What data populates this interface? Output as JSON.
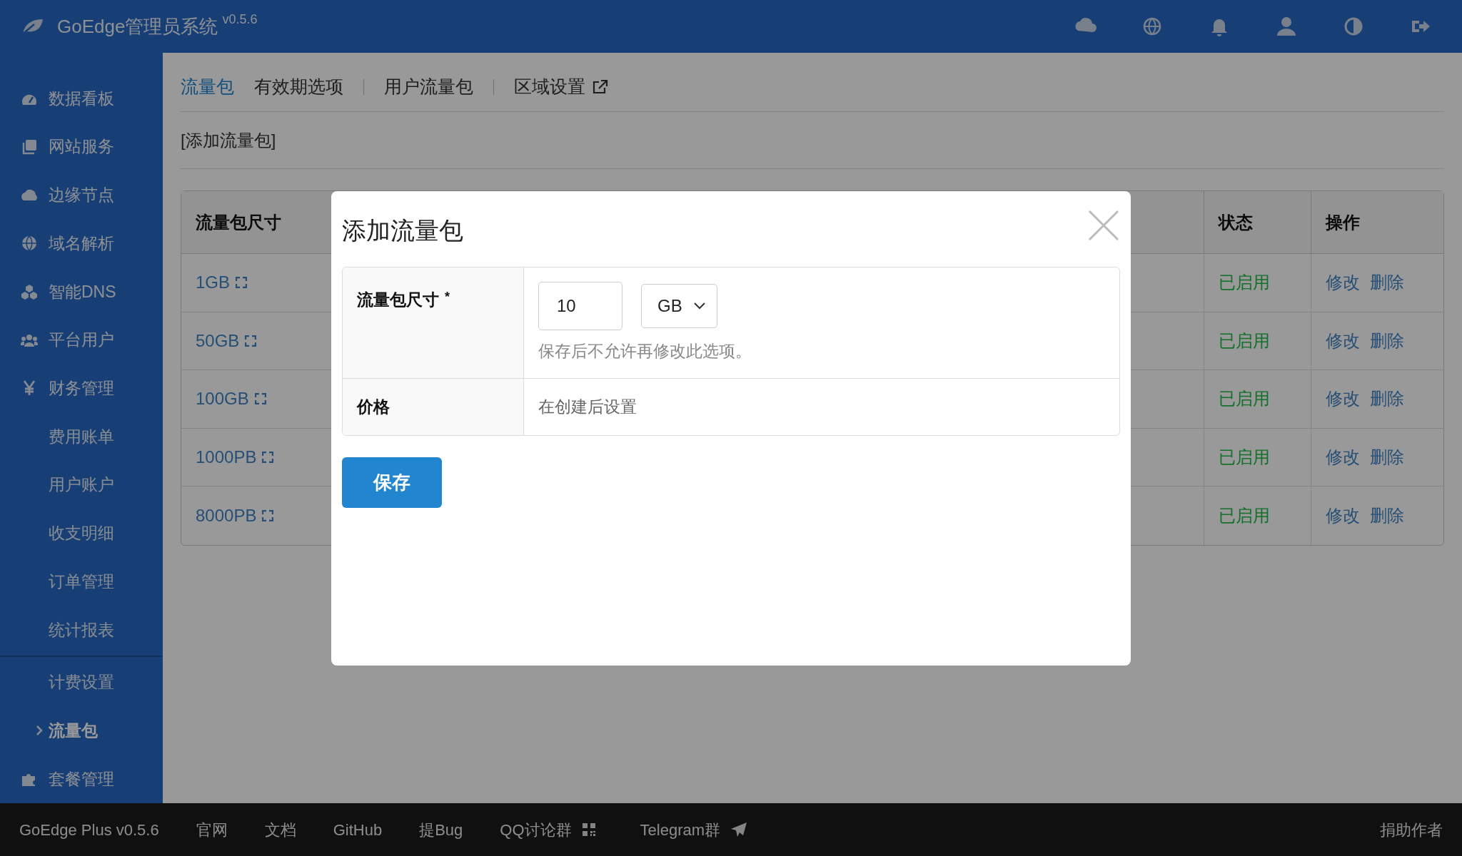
{
  "header": {
    "title": "GoEdge管理员系统",
    "version": "v0.5.6"
  },
  "sidebar": {
    "items": [
      {
        "label": "数据看板",
        "selected": false
      },
      {
        "label": "网站服务",
        "selected": false
      },
      {
        "label": "边缘节点",
        "selected": false
      },
      {
        "label": "域名解析",
        "selected": false
      },
      {
        "label": "智能DNS",
        "selected": false
      },
      {
        "label": "平台用户",
        "selected": false
      },
      {
        "label": "财务管理",
        "selected": false,
        "children": [
          {
            "label": "费用账单",
            "selected": false,
            "divider_before": false
          },
          {
            "label": "用户账户",
            "selected": false,
            "divider_before": false
          },
          {
            "label": "收支明细",
            "selected": false,
            "divider_before": false
          },
          {
            "label": "订单管理",
            "selected": false,
            "divider_before": false
          },
          {
            "label": "统计报表",
            "selected": false,
            "divider_before": false
          },
          {
            "label": "计费设置",
            "selected": false,
            "divider_before": true
          },
          {
            "label": "流量包",
            "selected": true,
            "divider_before": false
          }
        ]
      },
      {
        "label": "套餐管理",
        "selected": false
      }
    ]
  },
  "tabs": [
    {
      "label": "流量包",
      "selected": true,
      "external": false
    },
    {
      "label": "有效期选项",
      "selected": false,
      "external": false
    },
    {
      "label": "用户流量包",
      "selected": false,
      "external": false
    },
    {
      "label": "区域设置",
      "selected": false,
      "external": true
    }
  ],
  "add_link": "[添加流量包]",
  "table": {
    "columns": [
      "流量包尺寸",
      "状态",
      "操作"
    ],
    "rows": [
      {
        "size": "1GB",
        "status": "已启用",
        "actions": [
          "修改",
          "删除"
        ]
      },
      {
        "size": "50GB",
        "status": "已启用",
        "actions": [
          "修改",
          "删除"
        ]
      },
      {
        "size": "100GB",
        "status": "已启用",
        "actions": [
          "修改",
          "删除"
        ]
      },
      {
        "size": "1000PB",
        "status": "已启用",
        "actions": [
          "修改",
          "删除"
        ]
      },
      {
        "size": "8000PB",
        "status": "已启用",
        "actions": [
          "修改",
          "删除"
        ]
      }
    ]
  },
  "dialog": {
    "title": "添加流量包",
    "fields": [
      {
        "kind": "size",
        "label": "流量包尺寸",
        "required_mark": "*",
        "value": "10",
        "unit": "GB",
        "hint": "保存后不允许再修改此选项。"
      },
      {
        "kind": "text",
        "label": "价格",
        "text": "在创建后设置"
      }
    ],
    "save_button": "保存"
  },
  "footer": {
    "links": [
      "GoEdge Plus v0.5.6",
      "官网",
      "文档",
      "GitHub",
      "提Bug",
      "QQ讨论群",
      "Telegram群"
    ],
    "right": "捐助作者"
  }
}
